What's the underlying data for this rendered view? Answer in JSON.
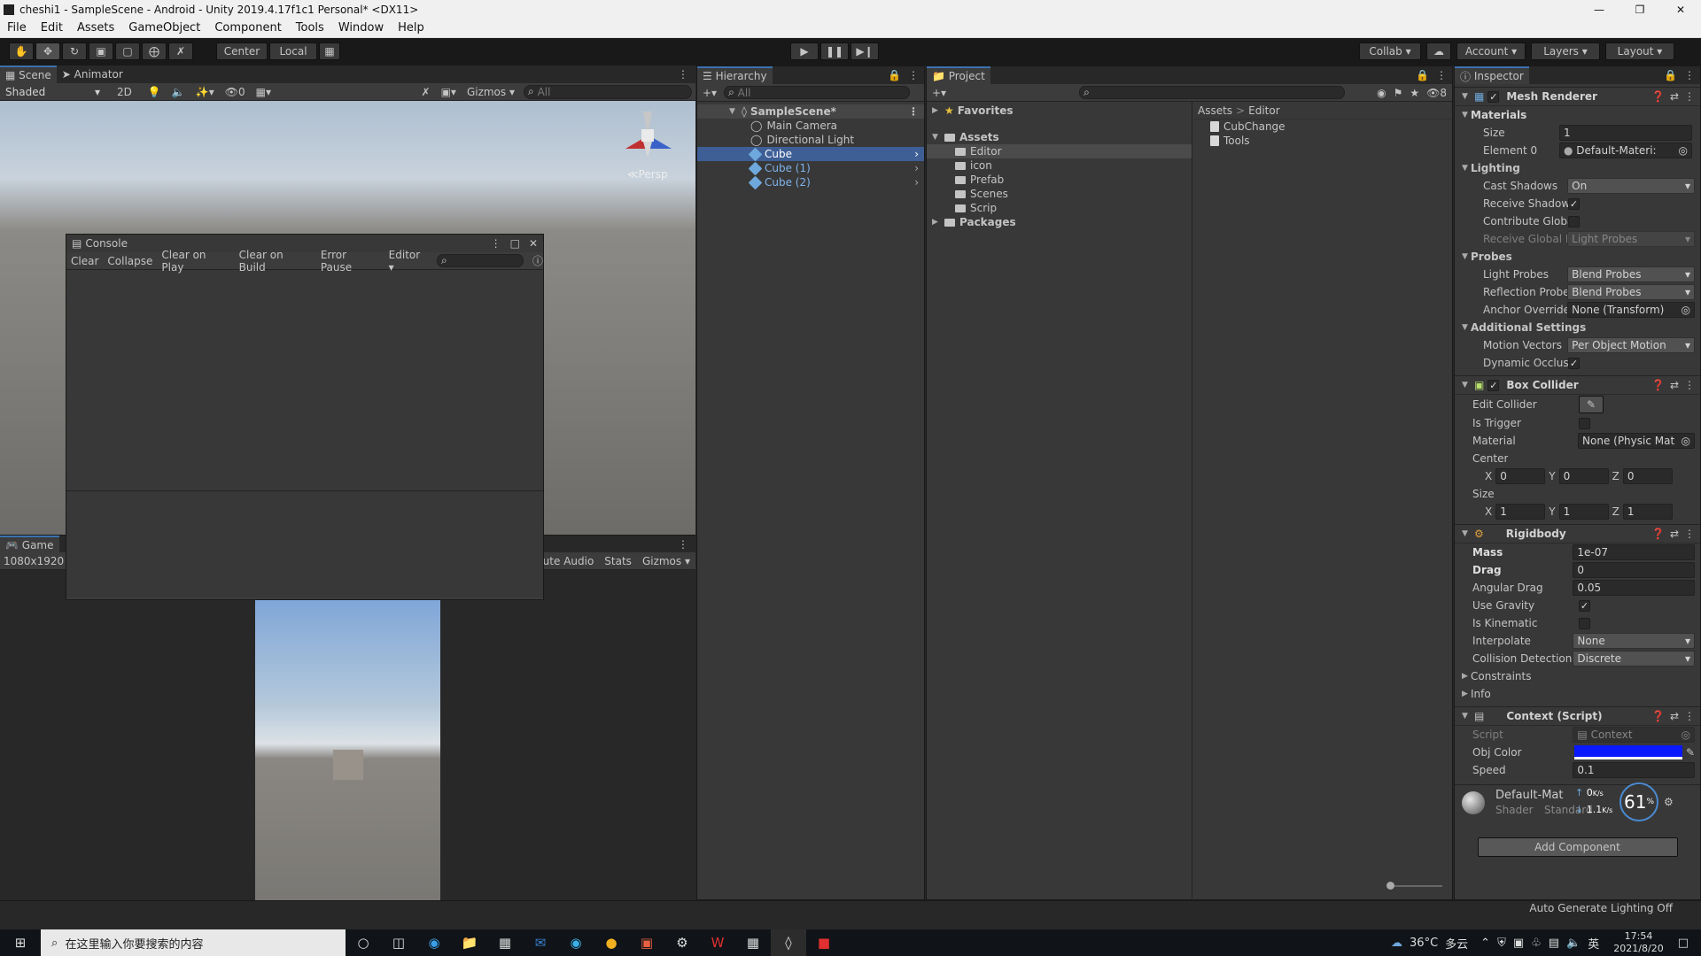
{
  "window": {
    "title": "cheshi1 - SampleScene - Android - Unity 2019.4.17f1c1 Personal* <DX11>"
  },
  "menu": [
    "File",
    "Edit",
    "Assets",
    "GameObject",
    "Component",
    "Tools",
    "Window",
    "Help"
  ],
  "toolbar": {
    "center": "Center",
    "local": "Local",
    "collab": "Collab",
    "account": "Account",
    "layers": "Layers",
    "layout": "Layout"
  },
  "scene": {
    "tab_scene": "Scene",
    "tab_animator": "Animator",
    "shading": "Shaded",
    "mode2d": "2D",
    "gizmos": "Gizmos",
    "search_placeholder": "All",
    "persp": "Persp",
    "hidden_count": "0"
  },
  "console": {
    "title": "Console",
    "buttons": [
      "Clear",
      "Collapse",
      "Clear on Play",
      "Clear on Build",
      "Error Pause"
    ],
    "editor": "Editor"
  },
  "game": {
    "tab": "Game",
    "resolution": "1080x1920",
    "mute": "Mute Audio",
    "stats": "Stats",
    "gizmos": "Gizmos"
  },
  "hierarchy": {
    "tab": "Hierarchy",
    "search_placeholder": "All",
    "scene": "SampleScene*",
    "items": [
      "Main Camera",
      "Directional Light",
      "Cube",
      "Cube (1)",
      "Cube (2)"
    ],
    "selected": "Cube"
  },
  "project": {
    "tab": "Project",
    "favorites": "Favorites",
    "assets": "Assets",
    "folders": [
      "Editor",
      "icon",
      "Prefab",
      "Scenes",
      "Scrip"
    ],
    "packages": "Packages",
    "breadcrumb_root": "Assets",
    "breadcrumb_sep": ">",
    "breadcrumb_current": "Editor",
    "files": [
      "CubChange",
      "Tools"
    ],
    "badge_count": "8"
  },
  "inspector": {
    "tab": "Inspector",
    "mesh_renderer": {
      "title": "Mesh Renderer",
      "materials": "Materials",
      "size_label": "Size",
      "size": "1",
      "element0_label": "Element 0",
      "element0": "Default-Materi:",
      "lighting": "Lighting",
      "cast_shadows_label": "Cast Shadows",
      "cast_shadows": "On",
      "receive_shadows_label": "Receive Shadows",
      "contribute_label": "Contribute Global I",
      "receive_gi_label": "Receive Global Illu",
      "receive_gi": "Light Probes",
      "probes": "Probes",
      "light_probes_label": "Light Probes",
      "light_probes": "Blend Probes",
      "reflection_probes_label": "Reflection Probes",
      "reflection_probes": "Blend Probes",
      "anchor_label": "Anchor Override",
      "anchor": "None (Transform)",
      "additional": "Additional Settings",
      "motion_label": "Motion Vectors",
      "motion": "Per Object Motion",
      "occlusion_label": "Dynamic Occlusio"
    },
    "box_collider": {
      "title": "Box Collider",
      "edit_label": "Edit Collider",
      "trigger_label": "Is Trigger",
      "material_label": "Material",
      "material": "None (Physic Mat",
      "center_label": "Center",
      "size_label": "Size",
      "x": "X",
      "y": "Y",
      "z": "Z",
      "center": [
        "0",
        "0",
        "0"
      ],
      "size": [
        "1",
        "1",
        "1"
      ]
    },
    "rigidbody": {
      "title": "Rigidbody",
      "mass_label": "Mass",
      "mass": "1e-07",
      "drag_label": "Drag",
      "drag": "0",
      "angular_label": "Angular Drag",
      "angular": "0.05",
      "gravity_label": "Use Gravity",
      "kinematic_label": "Is Kinematic",
      "interpolate_label": "Interpolate",
      "interpolate": "None",
      "collision_label": "Collision Detection",
      "collision": "Discrete",
      "constraints": "Constraints",
      "info": "Info"
    },
    "context": {
      "title": "Context (Script)",
      "script_label": "Script",
      "script": "Context",
      "color_label": "Obj Color",
      "obj_color": "#0a18ff",
      "speed_label": "Speed",
      "speed": "0.1"
    },
    "material": {
      "name": "Default-Mat",
      "shader_label": "Shader",
      "shader": "Standard"
    },
    "add_component": "Add Component",
    "net_overlay": {
      "percent": "61",
      "unit": "%",
      "up": "0",
      "up_unit": "K/s",
      "down": "1.1",
      "down_unit": "K/s"
    }
  },
  "status": {
    "auto_lighting": "Auto Generate Lighting Off"
  },
  "taskbar": {
    "search_placeholder": "在这里输入你要搜索的内容",
    "temperature": "36°C",
    "weather": "多云",
    "ime": "英",
    "time": "17:54",
    "date": "2021/8/20"
  },
  "colors": {
    "selection": "#3e5f96",
    "accent": "#3a72b0"
  }
}
